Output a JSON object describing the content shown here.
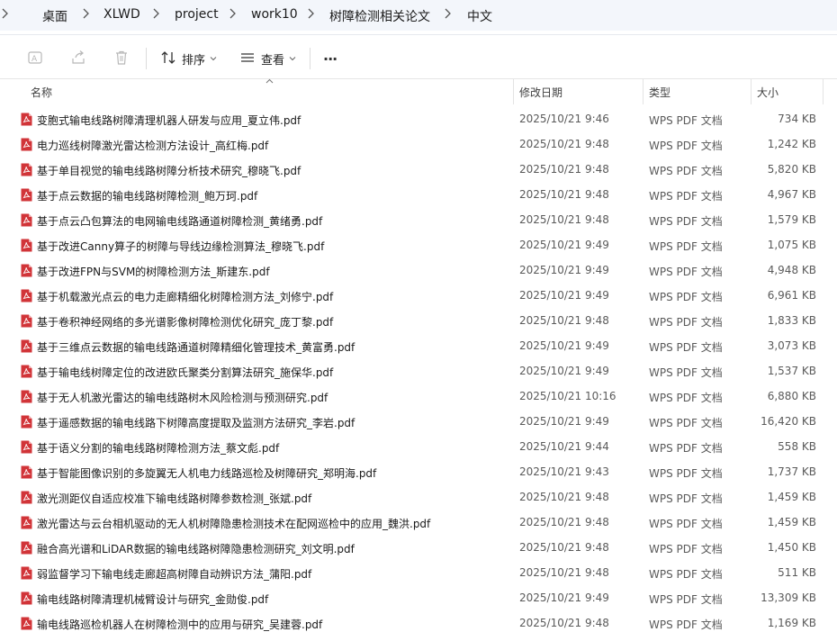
{
  "breadcrumb": {
    "items": [
      "桌面",
      "XLWD",
      "project",
      "work10",
      "树障检测相关论文",
      "中文"
    ]
  },
  "toolbar": {
    "sort_label": "排序",
    "view_label": "查看",
    "more_label": "···"
  },
  "columns": {
    "name": "名称",
    "date": "修改日期",
    "type": "类型",
    "size": "大小"
  },
  "colors": {
    "pdf_icon": "#d13438",
    "breadcrumb_bg": "#f3f6fb",
    "header_text": "#3f3f3f"
  },
  "files": [
    {
      "name": "变胞式输电线路树障清理机器人研发与应用_夏立伟.pdf",
      "date": "2025/10/21 9:46",
      "type": "WPS PDF 文档",
      "size": "734 KB"
    },
    {
      "name": "电力巡线树障激光雷达检测方法设计_高红梅.pdf",
      "date": "2025/10/21 9:48",
      "type": "WPS PDF 文档",
      "size": "1,242 KB"
    },
    {
      "name": "基于单目视觉的输电线路树障分析技术研究_穆晓飞.pdf",
      "date": "2025/10/21 9:48",
      "type": "WPS PDF 文档",
      "size": "5,820 KB"
    },
    {
      "name": "基于点云数据的输电线路树障检测_鲍万珂.pdf",
      "date": "2025/10/21 9:48",
      "type": "WPS PDF 文档",
      "size": "4,967 KB"
    },
    {
      "name": "基于点云凸包算法的电网输电线路通道树障检测_黄绪勇.pdf",
      "date": "2025/10/21 9:48",
      "type": "WPS PDF 文档",
      "size": "1,579 KB"
    },
    {
      "name": "基于改进Canny算子的树障与导线边缘检测算法_穆晓飞.pdf",
      "date": "2025/10/21 9:49",
      "type": "WPS PDF 文档",
      "size": "1,075 KB"
    },
    {
      "name": "基于改进FPN与SVM的树障检测方法_斯建东.pdf",
      "date": "2025/10/21 9:49",
      "type": "WPS PDF 文档",
      "size": "4,948 KB"
    },
    {
      "name": "基于机载激光点云的电力走廊精细化树障检测方法_刘修宁.pdf",
      "date": "2025/10/21 9:49",
      "type": "WPS PDF 文档",
      "size": "6,961 KB"
    },
    {
      "name": "基于卷积神经网络的多光谱影像树障检测优化研究_庞丁黎.pdf",
      "date": "2025/10/21 9:48",
      "type": "WPS PDF 文档",
      "size": "1,833 KB"
    },
    {
      "name": "基于三维点云数据的输电线路通道树障精细化管理技术_黄富勇.pdf",
      "date": "2025/10/21 9:49",
      "type": "WPS PDF 文档",
      "size": "3,073 KB"
    },
    {
      "name": "基于输电线树障定位的改进欧氏聚类分割算法研究_施保华.pdf",
      "date": "2025/10/21 9:49",
      "type": "WPS PDF 文档",
      "size": "1,537 KB"
    },
    {
      "name": "基于无人机激光雷达的输电线路树木风险检测与预测研究.pdf",
      "date": "2025/10/21 10:16",
      "type": "WPS PDF 文档",
      "size": "6,880 KB"
    },
    {
      "name": "基于遥感数据的输电线路下树障高度提取及监测方法研究_李岩.pdf",
      "date": "2025/10/21 9:49",
      "type": "WPS PDF 文档",
      "size": "16,420 KB"
    },
    {
      "name": "基于语义分割的输电线路树障检测方法_蔡文彪.pdf",
      "date": "2025/10/21 9:44",
      "type": "WPS PDF 文档",
      "size": "558 KB"
    },
    {
      "name": "基于智能图像识别的多旋翼无人机电力线路巡检及树障研究_郑明海.pdf",
      "date": "2025/10/21 9:43",
      "type": "WPS PDF 文档",
      "size": "1,737 KB"
    },
    {
      "name": "激光测距仪自适应校准下输电线路树障参数检测_张斌.pdf",
      "date": "2025/10/21 9:48",
      "type": "WPS PDF 文档",
      "size": "1,459 KB"
    },
    {
      "name": "激光雷达与云台相机驱动的无人机树障隐患检测技术在配网巡检中的应用_魏洪.pdf",
      "date": "2025/10/21 9:48",
      "type": "WPS PDF 文档",
      "size": "1,459 KB"
    },
    {
      "name": "融合高光谱和LiDAR数据的输电线路树障隐患检测研究_刘文明.pdf",
      "date": "2025/10/21 9:48",
      "type": "WPS PDF 文档",
      "size": "1,450 KB"
    },
    {
      "name": "弱监督学习下输电线走廊超高树障自动辨识方法_蒲阳.pdf",
      "date": "2025/10/21 9:48",
      "type": "WPS PDF 文档",
      "size": "511 KB"
    },
    {
      "name": "输电线路树障清理机械臂设计与研究_金勋俊.pdf",
      "date": "2025/10/21 9:49",
      "type": "WPS PDF 文档",
      "size": "13,309 KB"
    },
    {
      "name": "输电线路巡检机器人在树障检测中的应用与研究_吴建蓉.pdf",
      "date": "2025/10/21 9:48",
      "type": "WPS PDF 文档",
      "size": "1,169 KB"
    }
  ]
}
